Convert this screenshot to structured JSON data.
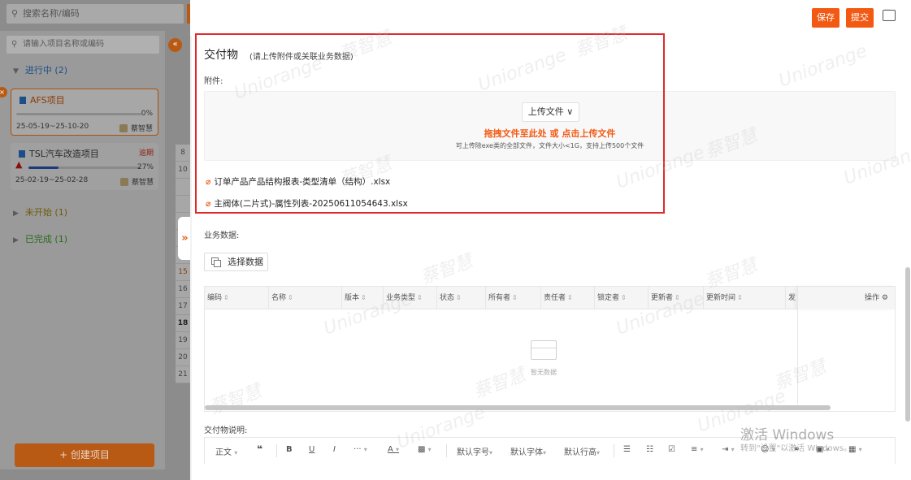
{
  "background": {
    "search_placeholder": "搜索名称/编码",
    "project_search_placeholder": "请输入项目名称或编码",
    "groups": {
      "in_progress": "进行中 (2)",
      "not_started": "未开始 (1)",
      "completed": "已完成 (1)"
    },
    "projects": [
      {
        "name": "AFS项目",
        "progress_label": "0%",
        "progress": 0,
        "dates": "25-05-19~25-10-20",
        "owner": "蔡智慧",
        "status": ""
      },
      {
        "name": "TSL汽车改造项目",
        "progress_label": "27%",
        "progress": 27,
        "dates": "25-02-19~25-02-28",
        "owner": "蔡智慧",
        "status": "逾期"
      }
    ],
    "day_numbers": [
      "8",
      "10",
      "",
      "",
      "",
      "",
      "14",
      "15",
      "16",
      "17",
      "18",
      "19",
      "20",
      "21"
    ],
    "create_button": "+ 创建项目"
  },
  "toolbar": {
    "save_label": "保存",
    "submit_label": "提交"
  },
  "deliverable": {
    "title": "交付物",
    "hint": "(请上传附件或关联业务数据)",
    "attachments_label": "附件:",
    "upload_button": "上传文件 ∨",
    "drag_text": "拖拽文件至此处 或 点击上传文件",
    "upload_hint": "可上传除exe类的全部文件，文件大小<1G，支持上传500个文件",
    "files": [
      "订单产品产品结构报表-类型清单（结构）.xlsx",
      "主阀体(二片式)-属性列表-20250611054643.xlsx"
    ]
  },
  "business_data": {
    "label": "业务数据:",
    "select_button": "选择数据",
    "columns": [
      "编码",
      "名称",
      "版本",
      "业务类型",
      "状态",
      "所有者",
      "责任者",
      "锁定者",
      "更新者",
      "更新时间",
      "发"
    ],
    "actions_header": "操作",
    "empty_text": "暂无数据",
    "rows": []
  },
  "description": {
    "label": "交付物说明:",
    "toolbar": {
      "paragraph": "正文",
      "font_size": "默认字号",
      "font_family": "默认字体",
      "line_height": "默认行高"
    }
  },
  "os_watermark": {
    "line1": "激活 Windows",
    "line2": "转到\"设置\"以激活 Windows。"
  },
  "watermark_text": [
    "蔡智慧",
    "Uniorange"
  ]
}
